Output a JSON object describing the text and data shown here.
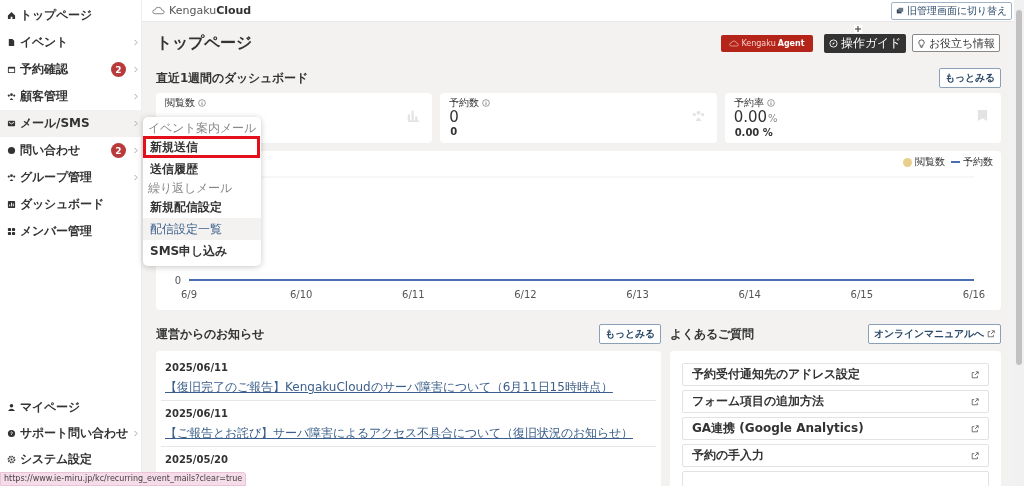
{
  "sidebar": {
    "items": [
      {
        "label": "トップページ",
        "has_children": false,
        "selected": false
      },
      {
        "label": "イベント",
        "has_children": true,
        "selected": false
      },
      {
        "label": "予約確認",
        "has_children": true,
        "selected": false,
        "badge": "2"
      },
      {
        "label": "顧客管理",
        "has_children": true,
        "selected": false
      },
      {
        "label": "メール/SMS",
        "has_children": true,
        "selected": true
      },
      {
        "label": "問い合わせ",
        "has_children": true,
        "selected": false,
        "badge": "2"
      },
      {
        "label": "グループ管理",
        "has_children": true,
        "selected": false
      },
      {
        "label": "ダッシュボード",
        "has_children": false,
        "selected": false
      },
      {
        "label": "メンバー管理",
        "has_children": false,
        "selected": false
      }
    ],
    "bottom_items": [
      {
        "label": "マイページ",
        "has_children": false
      },
      {
        "label": "サポート問い合わせ",
        "has_children": true
      },
      {
        "label": "システム設定",
        "has_children": false
      }
    ]
  },
  "popup_menu": [
    {
      "kind": "header",
      "label": "イベント案内メール"
    },
    {
      "kind": "item",
      "label": "新規送信",
      "selected": false,
      "highlighted": true
    },
    {
      "kind": "item",
      "label": "送信履歴",
      "selected": false,
      "highlighted": false
    },
    {
      "kind": "header",
      "label": "繰り返しメール"
    },
    {
      "kind": "item",
      "label": "新規配信設定",
      "selected": false,
      "highlighted": false
    },
    {
      "kind": "item",
      "label": "配信設定一覧",
      "selected": true,
      "highlighted": false
    },
    {
      "kind": "item",
      "label": "SMS申し込み",
      "selected": false,
      "highlighted": false
    }
  ],
  "header": {
    "logo_light": "Kengaku",
    "logo_bold": "Cloud",
    "switch_button": "旧管理画面に切り替え"
  },
  "page_title": "トップページ",
  "title_buttons": {
    "agent_light": "Kengaku",
    "agent_bold": "Agent",
    "guide": "操作ガイド",
    "tips": "お役立ち情報"
  },
  "dashboard": {
    "title": "直近1週間のダッシュボード",
    "more_button": "もっとみる",
    "cards": [
      {
        "label": "閲覧数"
      },
      {
        "label": "予約数",
        "value": "0",
        "sub": "0"
      },
      {
        "label": "予約率",
        "value": "0.00",
        "unit": "%",
        "sub": "0.00 %"
      }
    ],
    "chart": {
      "x_labels": [
        "6/9",
        "6/10",
        "6/11",
        "6/12",
        "6/13",
        "6/14",
        "6/15",
        "6/16"
      ],
      "y_labels": [
        "0"
      ],
      "legend": [
        {
          "kind": "dot",
          "name": "閲覧数",
          "color": "#e8cf8c"
        },
        {
          "kind": "line",
          "name": "予約数",
          "color": "#4a6cb3"
        }
      ]
    }
  },
  "news": {
    "title": "運営からのお知らせ",
    "more_button": "もっとみる",
    "items": [
      {
        "date": "2025/06/11",
        "link": "【復旧完了のご報告】KengakuCloudのサーバ障害について（6月11日15時時点）"
      },
      {
        "date": "2025/06/11",
        "link": "【ご報告とお詫び】サーバ障害によるアクセス不具合について（復旧状況のお知らせ）"
      },
      {
        "date": "2025/05/20"
      }
    ]
  },
  "faq": {
    "title": "よくあるご質問",
    "manual_button": "オンラインマニュアルへ",
    "items": [
      "予約受付通知先のアドレス設定",
      "フォーム項目の追加方法",
      "GA連携 (Google Analytics)",
      "予約の手入力"
    ]
  },
  "status_bar": "https://www.ie-miru.jp/kc/recurring_event_mails?clear=true"
}
